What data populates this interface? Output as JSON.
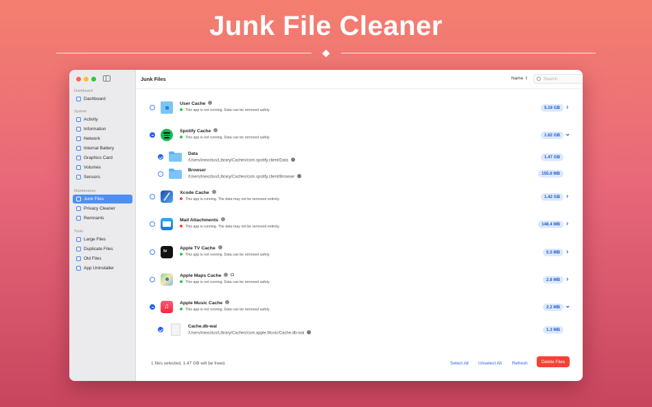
{
  "hero": {
    "title": "Junk File Cleaner"
  },
  "sidebar": {
    "sections": [
      {
        "label": "Dashboard",
        "items": [
          {
            "label": "Dashboard",
            "icon": "house-icon"
          }
        ]
      },
      {
        "label": "System",
        "items": [
          {
            "label": "Activity",
            "icon": "activity-icon"
          },
          {
            "label": "Information",
            "icon": "info-icon"
          },
          {
            "label": "Network",
            "icon": "globe-icon"
          },
          {
            "label": "Internal Battery",
            "icon": "battery-icon"
          },
          {
            "label": "Graphics Card",
            "icon": "gpu-icon"
          },
          {
            "label": "Volumes",
            "icon": "disk-icon"
          },
          {
            "label": "Sensors",
            "icon": "thermometer-icon"
          }
        ]
      },
      {
        "label": "Maintenance",
        "items": [
          {
            "label": "Junk Files",
            "icon": "trash-icon",
            "active": true
          },
          {
            "label": "Privacy Cleaner",
            "icon": "shield-icon"
          },
          {
            "label": "Remnants",
            "icon": "magnifier-icon"
          }
        ]
      },
      {
        "label": "Tools",
        "items": [
          {
            "label": "Large Files",
            "icon": "doc-icon"
          },
          {
            "label": "Duplicate Files",
            "icon": "duplicate-icon"
          },
          {
            "label": "Old Files",
            "icon": "clock-doc-icon"
          },
          {
            "label": "App Uninstaller",
            "icon": "uninstall-icon"
          }
        ]
      }
    ]
  },
  "main": {
    "title": "Junk Files",
    "sort_label": "Name",
    "search_placeholder": "Search"
  },
  "rows": [
    {
      "name": "User Cache",
      "status": "This app is not running. Data can be removed safely.",
      "status_color": "#28c840",
      "size": "5.19 GB",
      "selection": "none",
      "expanded": false,
      "icon": "folder-home-icon"
    },
    {
      "name": "Spotify Cache",
      "status": "This app is not running. Data can be removed safely.",
      "status_color": "#28c840",
      "size": "1.62 GB",
      "selection": "partial",
      "expanded": true,
      "icon": "spotify-icon",
      "children": [
        {
          "name": "Data",
          "path": "/Users/inexcitus/Library/Caches/com.spotify.client/Data",
          "size": "1.47 GB",
          "checked": true
        },
        {
          "name": "Browser",
          "path": "/Users/inexcitus/Library/Caches/com.spotify.client/Browser",
          "size": "155.6 MB",
          "checked": false
        }
      ]
    },
    {
      "name": "Xcode Cache",
      "status": "This app is running. The data may not be removed entirely.",
      "status_color": "#ff3b30",
      "size": "1.42 GB",
      "selection": "none",
      "expanded": false,
      "icon": "xcode-icon"
    },
    {
      "name": "Mail Attachments",
      "status": "This app is running. The data may not be removed entirely.",
      "status_color": "#ff3b30",
      "size": "148.4 MB",
      "selection": "none",
      "expanded": false,
      "icon": "mail-icon"
    },
    {
      "name": "Apple TV Cache",
      "status": "This app is not running. Data can be removed safely.",
      "status_color": "#28c840",
      "size": "5.5 MB",
      "selection": "none",
      "expanded": false,
      "icon": "apple-tv-icon"
    },
    {
      "name": "Apple Maps Cache",
      "status": "This app is not running. Data can be removed safely.",
      "status_color": "#28c840",
      "size": "2.8 MB",
      "selection": "none",
      "expanded": false,
      "icon": "maps-icon",
      "locked": true
    },
    {
      "name": "Apple Music Cache",
      "status": "This app is not running. Data can be removed safely.",
      "status_color": "#28c840",
      "size": "2.2 MB",
      "selection": "partial",
      "expanded": true,
      "icon": "music-icon",
      "children": [
        {
          "name": "Cache.db-wal",
          "path": "/Users/inexcitus/Library/Caches/com.apple.Music/Cache.db-wal",
          "size": "1.3 MB",
          "checked": true
        }
      ]
    }
  ],
  "footer": {
    "status": "1 files selected, 1.47 GB will be freed.",
    "select_all": "Select All",
    "unselect_all": "Unselect All",
    "refresh": "Refresh",
    "delete": "Delete Files"
  },
  "colors": {
    "accent": "#2563eb",
    "delete": "#f44236",
    "sidebar_active": "#4d8ff5"
  }
}
